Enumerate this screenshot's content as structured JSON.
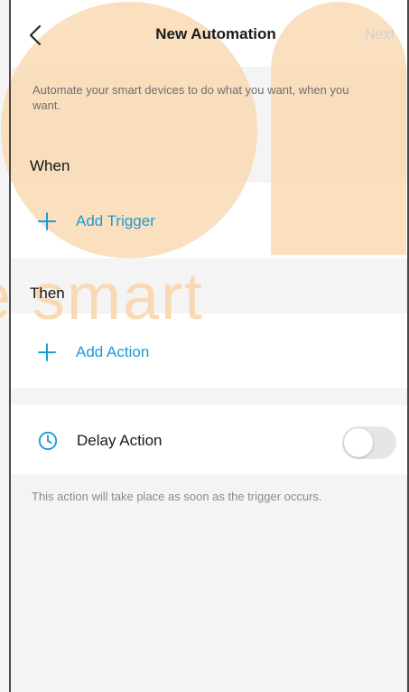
{
  "header": {
    "title": "New Automation",
    "next_label": "Next"
  },
  "intro": {
    "description": "Automate your smart devices to do what you want, when you want."
  },
  "sections": {
    "when_label": "When",
    "then_label": "Then"
  },
  "actions": {
    "add_trigger_label": "Add Trigger",
    "add_action_label": "Add Action"
  },
  "delay": {
    "label": "Delay Action",
    "enabled": false,
    "footnote": "This action will take place as soon as the trigger occurs."
  },
  "watermark": {
    "text": "e smart"
  },
  "colors": {
    "accent": "#1d9bd7",
    "muted_text": "#8b8b8b",
    "watermark": "#f9d7ad",
    "background": "#f4f4f4",
    "panel": "#ffffff"
  },
  "icons": {
    "back": "chevron-left-icon",
    "plus": "plus-icon",
    "clock": "clock-icon"
  }
}
